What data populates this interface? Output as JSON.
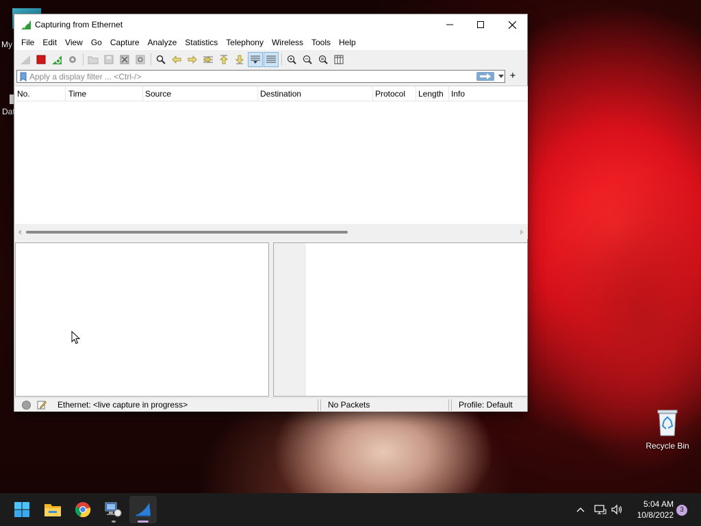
{
  "desktop": {
    "partial_icon_labels": [
      "My",
      "Dat"
    ],
    "recycle_bin_label": "Recycle Bin"
  },
  "window": {
    "title": "Capturing from Ethernet",
    "menu": [
      "File",
      "Edit",
      "View",
      "Go",
      "Capture",
      "Analyze",
      "Statistics",
      "Telephony",
      "Wireless",
      "Tools",
      "Help"
    ]
  },
  "toolbar": {
    "icons": [
      "start-capture-icon",
      "stop-capture-icon",
      "restart-capture-icon",
      "capture-options-icon",
      "open-file-icon",
      "save-file-icon",
      "close-file-icon",
      "reload-file-icon",
      "find-packet-icon",
      "go-back-icon",
      "go-forward-icon",
      "go-to-packet-icon",
      "go-first-icon",
      "go-last-icon",
      "autoscroll-icon",
      "colorize-icon",
      "zoom-in-icon",
      "zoom-out-icon",
      "normal-size-icon",
      "resize-columns-icon"
    ]
  },
  "filter": {
    "placeholder": "Apply a display filter ... <Ctrl-/>",
    "add_label": "+"
  },
  "packet_list": {
    "columns": [
      "No.",
      "Time",
      "Source",
      "Destination",
      "Protocol",
      "Length",
      "Info"
    ]
  },
  "status": {
    "interface_text": "Ethernet: <live capture in progress>",
    "packets_text": "No Packets",
    "profile_text": "Profile: Default"
  },
  "taskbar": {
    "apps": [
      "start-icon",
      "file-explorer-icon",
      "chrome-icon",
      "network-app-icon",
      "wireshark-icon"
    ],
    "time": "5:04 AM",
    "date": "10/8/2022",
    "notification_count": "3"
  }
}
